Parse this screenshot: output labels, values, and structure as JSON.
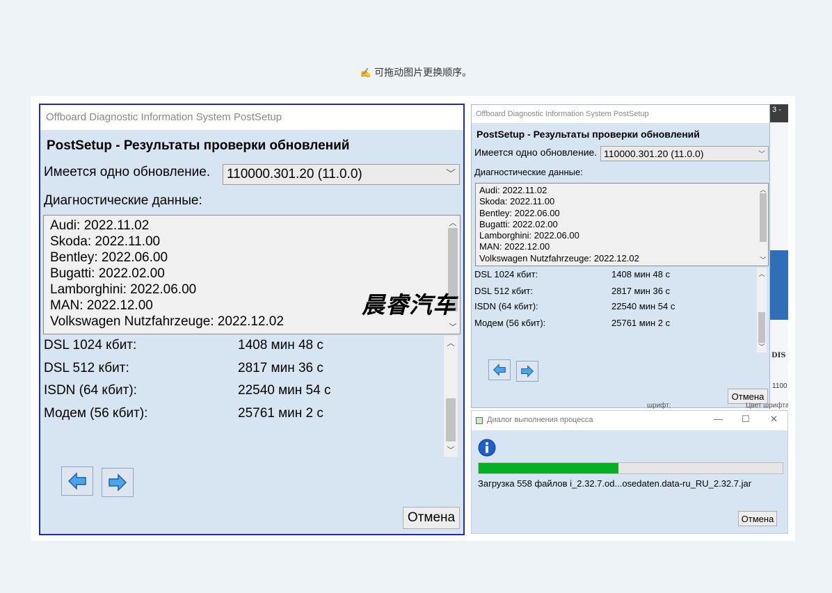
{
  "hint": {
    "text": "可拖动图片更换顺序。"
  },
  "colors": {
    "accent_border": "#1c2bb0",
    "progress_fill": "#06b025",
    "dialog_bg": "#d7e4f2"
  },
  "main_dialog": {
    "title": "Offboard Diagnostic Information System PostSetup",
    "heading": "PostSetup - Результаты проверки обновлений",
    "update_label": "Имеется одно обновление.",
    "update_selected": "110000.301.20 (11.0.0)",
    "diag_label": "Диагностические данные:",
    "diag_lines": [
      "Audi: 2022.11.02",
      "Skoda: 2022.11.00",
      "Bentley: 2022.06.00",
      "Bugatti: 2022.02.00",
      "Lamborghini: 2022.06.00",
      "MAN: 2022.12.00",
      "Volkswagen Nutzfahrzeuge: 2022.12.02"
    ],
    "speeds": [
      {
        "label": "DSL 1024 кбит:",
        "value": "1408 мин 48 с"
      },
      {
        "label": "DSL 512 кбит:",
        "value": "2817 мин 36 с"
      },
      {
        "label": "ISDN (64 кбит):",
        "value": "22540 мин 54 с"
      },
      {
        "label": "Модем (56 кбит):",
        "value": "25761 мин 2 с"
      }
    ],
    "back_icon": "arrow-left-icon",
    "next_icon": "arrow-right-icon",
    "cancel_label": "Отмена"
  },
  "progress_dialog": {
    "title": "Диалог выполнения процесса",
    "progress": 0.46,
    "status": "Загрузка 558 файлов i_2.32.7.od...osedaten.data-ru_RU_2.32.7.jar",
    "cancel_label": "Отмена",
    "info_icon": "info-icon"
  },
  "background_app": {
    "frag1": "3 -",
    "frag2": "DIS S",
    "frag3": "1100",
    "frag4": "шрифт:",
    "frag5": "Цвет шрифта:"
  },
  "watermark": "晨睿汽车"
}
